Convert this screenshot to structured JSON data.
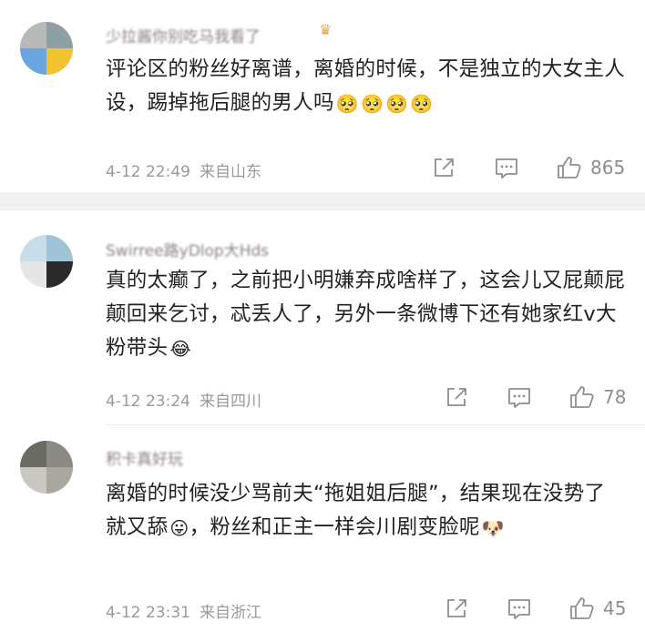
{
  "comments": [
    {
      "username": "少拉酱你别吃马我看了",
      "badge_icon": "crown-badge-icon",
      "text": "评论区的粉丝好离谱，离婚的时候，不是独立的大女主人设，踢掉拖后腿的男人吗",
      "emojis": [
        "🥺",
        "🥺",
        "🥺",
        "🥺"
      ],
      "date": "4-12 22:49",
      "location": "来自山东",
      "likes": "865",
      "avatar_colors": [
        "#b8bab9",
        "#8fa0a5",
        "#6aa7e0",
        "#f2c230"
      ]
    },
    {
      "username": "Swirree路yDlop大Hds",
      "badge_icon": "",
      "text": "真的太癫了，之前把小明嫌弃成啥样了，这会儿又屁颠屁颠回来乞讨，忒丢人了，另外一条微博下还有她家红v大粉带头",
      "emojis": [
        "😂"
      ],
      "date": "4-12 23:24",
      "location": "来自四川",
      "likes": "78",
      "avatar_colors": [
        "#c9dde8",
        "#9fc4d8",
        "#e6e6e6",
        "#2a2a2a"
      ]
    },
    {
      "username": "积卡真好玩",
      "badge_icon": "",
      "text": "离婚的时候没少骂前夫“拖姐姐后腿”，结果现在没势了就又舔",
      "text2": "，粉丝和正主一样会川剧变脸呢",
      "emojis": [
        "😛"
      ],
      "emojis2": [
        "🐶"
      ],
      "date": "4-12 23:31",
      "location": "来自浙江",
      "likes": "45",
      "avatar_colors": [
        "#6b6b66",
        "#8c8a83",
        "#c9c7bf",
        "#a9a79f"
      ]
    }
  ]
}
